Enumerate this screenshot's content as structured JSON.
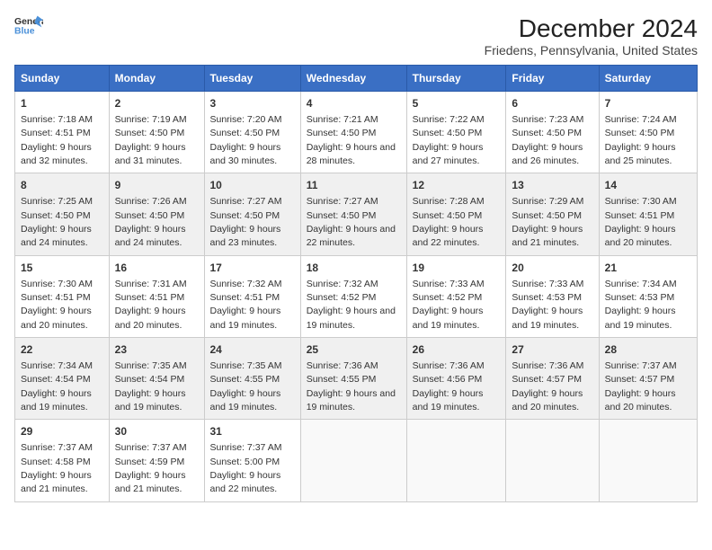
{
  "logo": {
    "line1": "General",
    "line2": "Blue"
  },
  "title": "December 2024",
  "subtitle": "Friedens, Pennsylvania, United States",
  "days_of_week": [
    "Sunday",
    "Monday",
    "Tuesday",
    "Wednesday",
    "Thursday",
    "Friday",
    "Saturday"
  ],
  "weeks": [
    [
      {
        "day": "1",
        "sunrise": "7:18 AM",
        "sunset": "4:51 PM",
        "daylight": "9 hours and 32 minutes."
      },
      {
        "day": "2",
        "sunrise": "7:19 AM",
        "sunset": "4:50 PM",
        "daylight": "9 hours and 31 minutes."
      },
      {
        "day": "3",
        "sunrise": "7:20 AM",
        "sunset": "4:50 PM",
        "daylight": "9 hours and 30 minutes."
      },
      {
        "day": "4",
        "sunrise": "7:21 AM",
        "sunset": "4:50 PM",
        "daylight": "9 hours and 28 minutes."
      },
      {
        "day": "5",
        "sunrise": "7:22 AM",
        "sunset": "4:50 PM",
        "daylight": "9 hours and 27 minutes."
      },
      {
        "day": "6",
        "sunrise": "7:23 AM",
        "sunset": "4:50 PM",
        "daylight": "9 hours and 26 minutes."
      },
      {
        "day": "7",
        "sunrise": "7:24 AM",
        "sunset": "4:50 PM",
        "daylight": "9 hours and 25 minutes."
      }
    ],
    [
      {
        "day": "8",
        "sunrise": "7:25 AM",
        "sunset": "4:50 PM",
        "daylight": "9 hours and 24 minutes."
      },
      {
        "day": "9",
        "sunrise": "7:26 AM",
        "sunset": "4:50 PM",
        "daylight": "9 hours and 24 minutes."
      },
      {
        "day": "10",
        "sunrise": "7:27 AM",
        "sunset": "4:50 PM",
        "daylight": "9 hours and 23 minutes."
      },
      {
        "day": "11",
        "sunrise": "7:27 AM",
        "sunset": "4:50 PM",
        "daylight": "9 hours and 22 minutes."
      },
      {
        "day": "12",
        "sunrise": "7:28 AM",
        "sunset": "4:50 PM",
        "daylight": "9 hours and 22 minutes."
      },
      {
        "day": "13",
        "sunrise": "7:29 AM",
        "sunset": "4:50 PM",
        "daylight": "9 hours and 21 minutes."
      },
      {
        "day": "14",
        "sunrise": "7:30 AM",
        "sunset": "4:51 PM",
        "daylight": "9 hours and 20 minutes."
      }
    ],
    [
      {
        "day": "15",
        "sunrise": "7:30 AM",
        "sunset": "4:51 PM",
        "daylight": "9 hours and 20 minutes."
      },
      {
        "day": "16",
        "sunrise": "7:31 AM",
        "sunset": "4:51 PM",
        "daylight": "9 hours and 20 minutes."
      },
      {
        "day": "17",
        "sunrise": "7:32 AM",
        "sunset": "4:51 PM",
        "daylight": "9 hours and 19 minutes."
      },
      {
        "day": "18",
        "sunrise": "7:32 AM",
        "sunset": "4:52 PM",
        "daylight": "9 hours and 19 minutes."
      },
      {
        "day": "19",
        "sunrise": "7:33 AM",
        "sunset": "4:52 PM",
        "daylight": "9 hours and 19 minutes."
      },
      {
        "day": "20",
        "sunrise": "7:33 AM",
        "sunset": "4:53 PM",
        "daylight": "9 hours and 19 minutes."
      },
      {
        "day": "21",
        "sunrise": "7:34 AM",
        "sunset": "4:53 PM",
        "daylight": "9 hours and 19 minutes."
      }
    ],
    [
      {
        "day": "22",
        "sunrise": "7:34 AM",
        "sunset": "4:54 PM",
        "daylight": "9 hours and 19 minutes."
      },
      {
        "day": "23",
        "sunrise": "7:35 AM",
        "sunset": "4:54 PM",
        "daylight": "9 hours and 19 minutes."
      },
      {
        "day": "24",
        "sunrise": "7:35 AM",
        "sunset": "4:55 PM",
        "daylight": "9 hours and 19 minutes."
      },
      {
        "day": "25",
        "sunrise": "7:36 AM",
        "sunset": "4:55 PM",
        "daylight": "9 hours and 19 minutes."
      },
      {
        "day": "26",
        "sunrise": "7:36 AM",
        "sunset": "4:56 PM",
        "daylight": "9 hours and 19 minutes."
      },
      {
        "day": "27",
        "sunrise": "7:36 AM",
        "sunset": "4:57 PM",
        "daylight": "9 hours and 20 minutes."
      },
      {
        "day": "28",
        "sunrise": "7:37 AM",
        "sunset": "4:57 PM",
        "daylight": "9 hours and 20 minutes."
      }
    ],
    [
      {
        "day": "29",
        "sunrise": "7:37 AM",
        "sunset": "4:58 PM",
        "daylight": "9 hours and 21 minutes."
      },
      {
        "day": "30",
        "sunrise": "7:37 AM",
        "sunset": "4:59 PM",
        "daylight": "9 hours and 21 minutes."
      },
      {
        "day": "31",
        "sunrise": "7:37 AM",
        "sunset": "5:00 PM",
        "daylight": "9 hours and 22 minutes."
      },
      null,
      null,
      null,
      null
    ]
  ],
  "labels": {
    "sunrise": "Sunrise:",
    "sunset": "Sunset:",
    "daylight": "Daylight:"
  }
}
